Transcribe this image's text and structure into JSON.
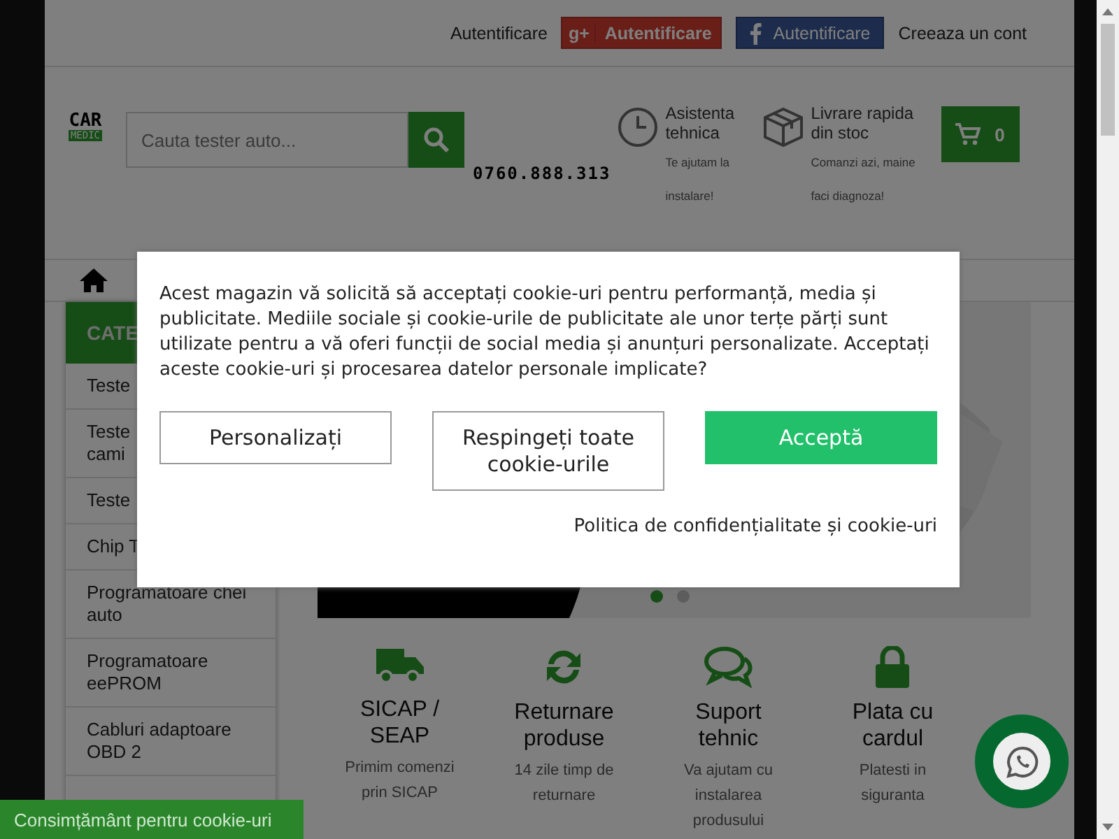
{
  "top_links": {
    "login": "Autentificare",
    "google_mark": "g+",
    "google_login": "Autentificare",
    "facebook_login": "Autentificare",
    "register": "Creeaza un cont"
  },
  "logo": {
    "top": "CAR",
    "bottom": "MEDIC"
  },
  "search": {
    "placeholder": "Cauta tester auto..."
  },
  "phone": "0760.888.313",
  "header_info": [
    {
      "kind": "clock",
      "title": "Asistenta tehnica",
      "subtitle": "Te ajutam la instalare!"
    },
    {
      "kind": "box",
      "title": "Livrare rapida din stoc",
      "subtitle": "Comanzi azi, maine faci diagnoza!"
    }
  ],
  "cart": {
    "count": "0"
  },
  "sidebar": {
    "title": "CATE",
    "items": [
      "Teste",
      "Teste cami",
      "Teste",
      "Chip T",
      "Programatoare chei auto",
      "Programatoare eePROM",
      "Cabluri adaptoare OBD 2"
    ]
  },
  "slider": {
    "dots": [
      {
        "selected": true
      },
      {
        "selected": false
      }
    ]
  },
  "features": [
    {
      "kind": "truck",
      "title": "SICAP / SEAP",
      "text": "Primim comenzi prin SICAP"
    },
    {
      "kind": "refresh",
      "title": "Returnare produse",
      "text": "14 zile timp de returnare"
    },
    {
      "kind": "chat",
      "title": "Suport tehnic",
      "text": "Va ajutam cu instalarea produsului"
    },
    {
      "kind": "lock",
      "title": "Plata cu cardul",
      "text": "Platesti in siguranta"
    }
  ],
  "cookie_modal": {
    "message": "Acest magazin vă solicită să acceptați cookie-uri pentru performanță, media și publicitate. Mediile sociale și cookie-urile de publicitate ale unor terțe părți sunt utilizate pentru a vă oferi funcții de social media și anunțuri personalizate. Acceptați aceste cookie-uri și procesarea datelor personale implicate?",
    "buttons": [
      {
        "kind": "outline",
        "label": "Personalizați"
      },
      {
        "kind": "outline",
        "label": "Respingeți toate cookie-urile"
      },
      {
        "kind": "primary",
        "label": "Acceptă"
      }
    ],
    "policy_link": "Politica de confidențialitate și cookie-uri"
  },
  "consent_tab": "Consimțământ pentru cookie-uri"
}
